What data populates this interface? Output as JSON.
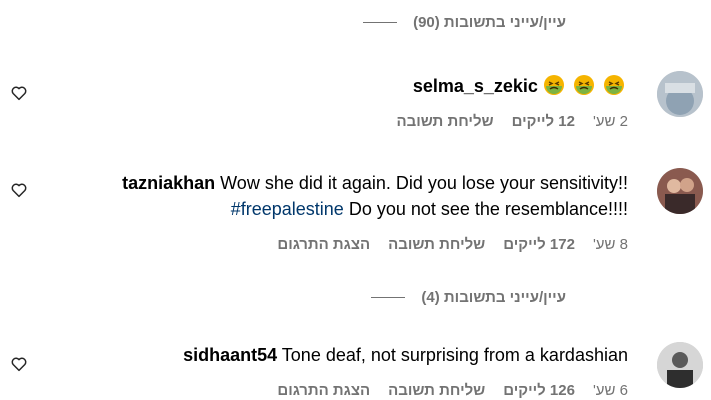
{
  "thread": {
    "view_replies_top": "עיין/עייני בתשובות (90)",
    "view_replies_mid": "עיין/עייני בתשובות (4)"
  },
  "comments": [
    {
      "username": "selma_s_zekic",
      "text": "",
      "emojis": [
        "nauseated-face",
        "nauseated-face",
        "nauseated-face"
      ],
      "time": "2 שע'",
      "likes": "12 לייקים",
      "reply": "שליחת תשובה"
    },
    {
      "username": "tazniakhan",
      "text_line1": "Wow she did it again. Did you lose your sensitivity!!",
      "text_line2": "Do you not see the resemblance!!!!",
      "hashtag": "#freepalestine",
      "time": "8 שע'",
      "likes": "172 לייקים",
      "reply": "שליחת תשובה",
      "translate": "הצגת התרגום"
    },
    {
      "username": "sidhaant54",
      "text": "Tone deaf, not surprising from a kardashian",
      "time": "6 שע'",
      "likes": "126 לייקים",
      "reply": "שליחת תשובה",
      "translate": "הצגת התרגום"
    }
  ],
  "colors": {
    "secondary_text": "#737373",
    "hashtag": "#00376b",
    "emoji_green": "#7cb342",
    "emoji_yellow": "#f5b400"
  },
  "icons": {
    "like": "heart-outline-icon"
  }
}
